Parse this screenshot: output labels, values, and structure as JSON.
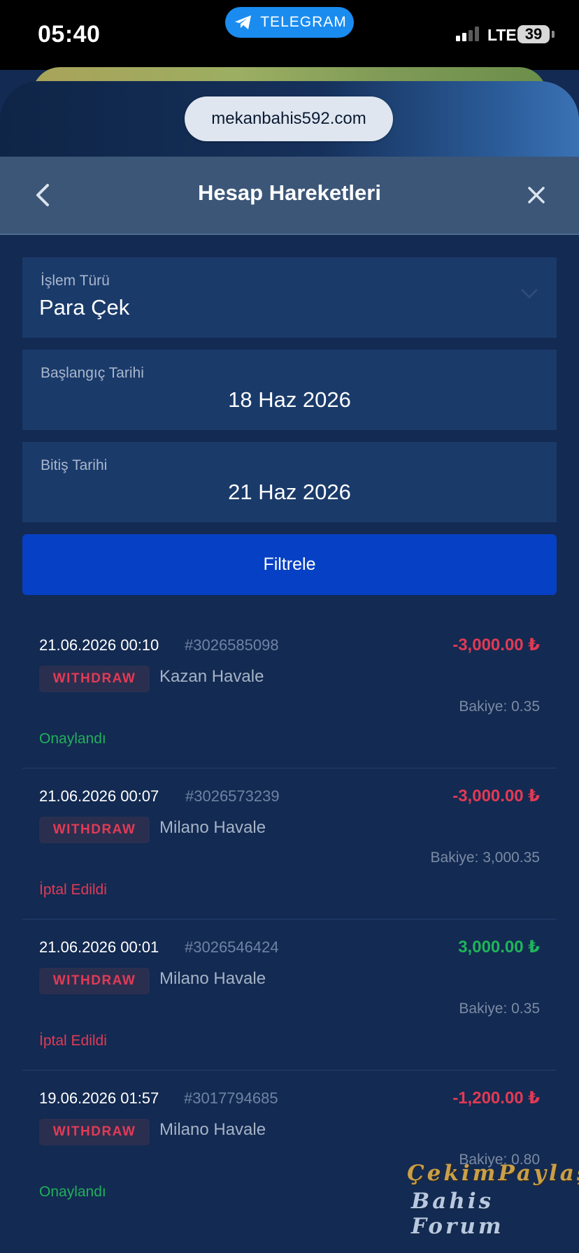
{
  "status_bar": {
    "time": "05:40",
    "telegram_label": "TELEGRAM",
    "network": "LTE",
    "battery": "39"
  },
  "browser": {
    "url": "mekanbahis592.com"
  },
  "header": {
    "title": "Hesap Hareketleri"
  },
  "filters": {
    "type_label": "İşlem Türü",
    "type_value": "Para Çek",
    "start_label": "Başlangıç Tarihi",
    "start_value": "18 Haz 2026",
    "end_label": "Bitiş Tarihi",
    "end_value": "21 Haz 2026",
    "button_label": "Filtrele"
  },
  "transactions": [
    {
      "datetime": "21.06.2026 00:10",
      "id": "#3026585098",
      "amount": "-3,000.00 ₺",
      "sign": "negative",
      "type": "WITHDRAW",
      "method": "Kazan Havale",
      "balance": "Bakiye: 0.35",
      "status": "Onaylandı",
      "status_kind": "approved"
    },
    {
      "datetime": "21.06.2026 00:07",
      "id": "#3026573239",
      "amount": "-3,000.00 ₺",
      "sign": "negative",
      "type": "WITHDRAW",
      "method": "Milano Havale",
      "balance": "Bakiye: 3,000.35",
      "status": "İptal Edildi",
      "status_kind": "cancelled"
    },
    {
      "datetime": "21.06.2026 00:01",
      "id": "#3026546424",
      "amount": "3,000.00 ₺",
      "sign": "positive",
      "type": "WITHDRAW",
      "method": "Milano Havale",
      "balance": "Bakiye: 0.35",
      "status": "İptal Edildi",
      "status_kind": "cancelled"
    },
    {
      "datetime": "19.06.2026 01:57",
      "id": "#3017794685",
      "amount": "-1,200.00 ₺",
      "sign": "negative",
      "type": "WITHDRAW",
      "method": "Milano Havale",
      "balance": "Bakiye: 0.80",
      "status": "Onaylandı",
      "status_kind": "approved"
    }
  ],
  "watermark": {
    "line1": "ÇekimPaylaş",
    "line2": "Bahis Forum"
  },
  "colors": {
    "background": "#132a52",
    "header": "#3c5678",
    "field": "#1a3a6a",
    "button": "#0640c4",
    "negative": "#e23a54",
    "positive": "#1fb55a"
  }
}
